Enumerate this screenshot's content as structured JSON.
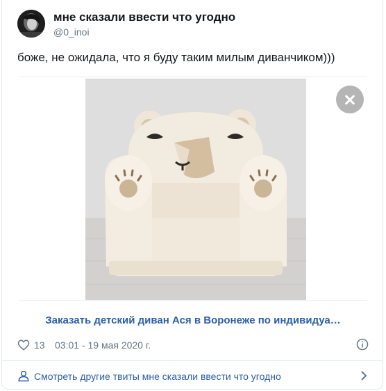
{
  "tweet": {
    "display_name": "мне сказали ввести что угодно",
    "handle": "@0_inoi",
    "text": "боже, не ожидала, что я буду таким милым диванчиком)))",
    "like_count": "13",
    "timestamp": "03:01 - 19 мая 2020 г."
  },
  "media": {
    "link_title": "Заказать детский диван Ася в Воронеже по индивидуа…",
    "close_icon": "close-icon"
  },
  "footer": {
    "more_tweets_label": "Смотреть другие твиты мне сказали ввести что угодно"
  },
  "colors": {
    "link": "#2b5ea8",
    "muted": "#657786",
    "border": "#e1e8ed"
  }
}
